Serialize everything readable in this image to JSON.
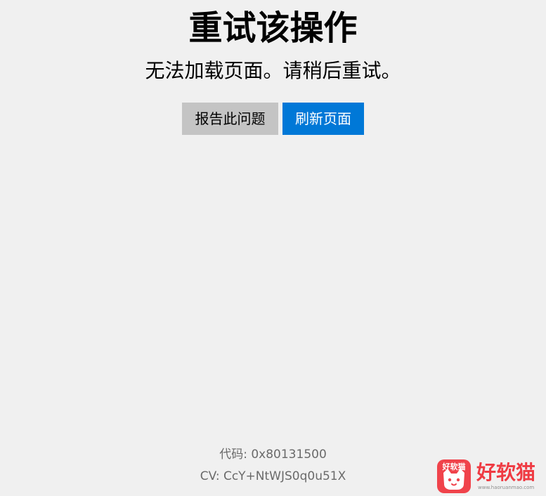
{
  "error": {
    "title": "重试该操作",
    "message": "无法加载页面。请稍后重试。"
  },
  "actions": {
    "report_label": "报告此问题",
    "refresh_label": "刷新页面"
  },
  "details": {
    "code_label": "代码:",
    "code_value": "0x80131500",
    "cv_label": "CV:",
    "cv_value": "CcY+NtWJS0q0u51X"
  },
  "watermark": {
    "icon_text": "好软猫",
    "name": "好软猫",
    "url": "www.haoruanmao.com"
  },
  "colors": {
    "background": "#f0f0f0",
    "primary_button": "#0078d7",
    "secondary_button": "#c4c4c4",
    "muted_text": "#6a6a6a",
    "watermark_red": "#ef3b43"
  }
}
